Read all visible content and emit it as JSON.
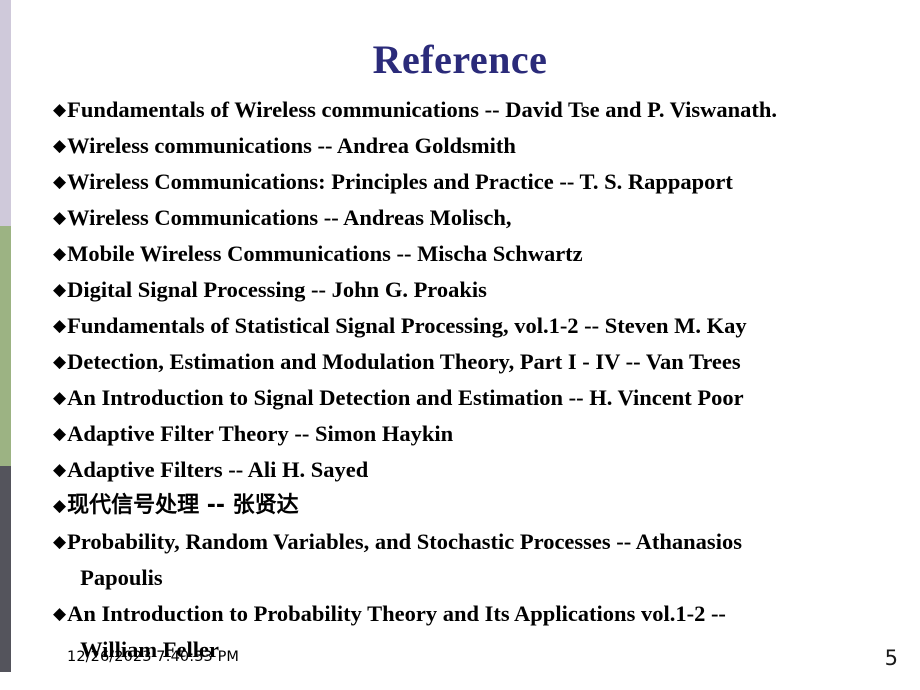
{
  "slide": {
    "title": "Reference",
    "title_color": "#2b2b7a",
    "background_color": "#ffffff",
    "bullet_glyph": "◆"
  },
  "side_stripe": {
    "segments": [
      {
        "name": "lavender",
        "color": "#cfc9da"
      },
      {
        "name": "green",
        "color": "#9cb383"
      },
      {
        "name": "gray",
        "color": "#54545c"
      }
    ]
  },
  "references": [
    {
      "text": "Fundamentals of Wireless communications -- David Tse and P. Viswanath.",
      "wrapped": false,
      "cjk": false
    },
    {
      "text": "Wireless communications -- Andrea Goldsmith",
      "wrapped": false,
      "cjk": false
    },
    {
      "text": "Wireless Communications: Principles and Practice -- T. S. Rappaport",
      "wrapped": false,
      "cjk": false
    },
    {
      "text": "Wireless Communications -- Andreas Molisch,",
      "wrapped": false,
      "cjk": false
    },
    {
      "text": "Mobile Wireless Communications -- Mischa Schwartz",
      "wrapped": false,
      "cjk": false
    },
    {
      "text": "Digital Signal Processing -- John G. Proakis",
      "wrapped": false,
      "cjk": false
    },
    {
      "text": "Fundamentals of Statistical Signal Processing, vol.1-2 -- Steven M. Kay",
      "wrapped": false,
      "cjk": false
    },
    {
      "text": "Detection, Estimation and Modulation Theory, Part I - IV -- Van Trees",
      "wrapped": false,
      "cjk": false
    },
    {
      "text": "An Introduction to Signal Detection and Estimation -- H. Vincent Poor",
      "wrapped": false,
      "cjk": false
    },
    {
      "text": "Adaptive Filter Theory -- Simon Haykin",
      "wrapped": false,
      "cjk": false
    },
    {
      "text": "Adaptive Filters -- Ali H. Sayed",
      "wrapped": false,
      "cjk": false
    },
    {
      "text": "现代信号处理 -- 张贤达",
      "wrapped": false,
      "cjk": true
    },
    {
      "text": "Probability, Random Variables, and Stochastic Processes -- Athanasios",
      "line2": "Papoulis",
      "wrapped": true,
      "cjk": false
    },
    {
      "text": "An Introduction to Probability Theory and Its Applications vol.1-2 --",
      "line2": "William Feller",
      "wrapped": true,
      "cjk": false
    }
  ],
  "footer": {
    "timestamp": "12/26/2023 7:40:33 PM",
    "page_number": "5"
  }
}
